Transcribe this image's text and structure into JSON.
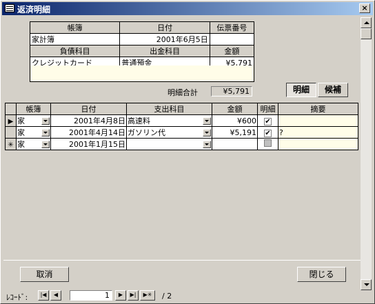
{
  "window": {
    "title": "返済明細",
    "close_label": "×"
  },
  "header_table": {
    "row1_headers": [
      "帳簿",
      "日付",
      "伝票番号"
    ],
    "row1_values": [
      "家計簿",
      "2001年6月5日",
      ""
    ],
    "row2_headers": [
      "負債科目",
      "出金科目",
      "金額"
    ],
    "row2_values": [
      "クレジットカード",
      "普通預金",
      "¥5,791"
    ]
  },
  "total": {
    "label": "明細合計",
    "value": "¥5,791"
  },
  "tabs": [
    "明細",
    "候補"
  ],
  "grid": {
    "columns": [
      "帳簿",
      "日付",
      "支出科目",
      "金額",
      "明細",
      "摘要"
    ],
    "rows": [
      {
        "marker": "▶",
        "book": "家",
        "date": "2001年4月8日",
        "account": "高速料",
        "amount": "¥600",
        "detail": "✔",
        "memo": ""
      },
      {
        "marker": "",
        "book": "家",
        "date": "2001年4月14日",
        "account": "ガソリン代",
        "amount": "¥5,191",
        "detail": "✔",
        "memo": "?"
      },
      {
        "marker": "✳",
        "book": "家",
        "date": "2001年1月15日",
        "account": "",
        "amount": "",
        "detail": "",
        "memo": ""
      }
    ]
  },
  "buttons": {
    "cancel": "取消",
    "close": "閉じる"
  },
  "navigation": {
    "label": "ﾚｺｰﾄﾞ:",
    "current": "1",
    "of_total": "/ 2"
  }
}
